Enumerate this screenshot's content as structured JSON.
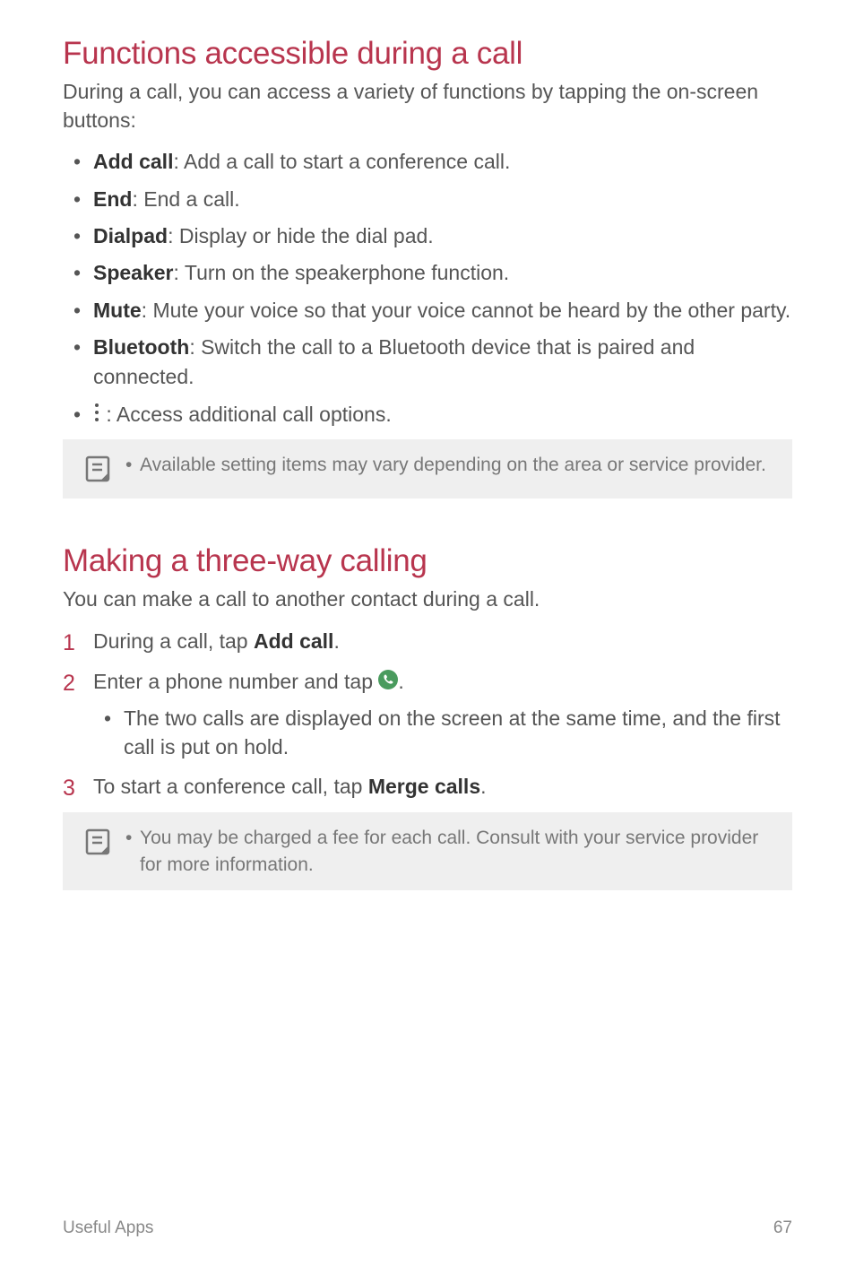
{
  "section1": {
    "heading": "Functions accessible during a call",
    "intro": "During a call, you can access a variety of functions by tapping the on-screen buttons:",
    "items": [
      {
        "label": "Add call",
        "desc": ": Add a call to start a conference call."
      },
      {
        "label": "End",
        "desc": ": End a call."
      },
      {
        "label": "Dialpad",
        "desc": ": Display or hide the dial pad."
      },
      {
        "label": "Speaker",
        "desc": ": Turn on the speakerphone function."
      },
      {
        "label": "Mute",
        "desc": ": Mute your voice so that your voice cannot be heard by the other party."
      },
      {
        "label": "Bluetooth",
        "desc": ": Switch the call to a Bluetooth device that is paired and connected."
      }
    ],
    "moreOptionsDesc": " : Access additional call options.",
    "note": "Available setting items may vary depending on the area or service provider."
  },
  "section2": {
    "heading": "Making a three-way calling",
    "intro": "You can make a call to another contact during a call.",
    "step1_pre": "During a call, tap ",
    "step1_bold": "Add call",
    "step1_post": ".",
    "step2_pre": "Enter a phone number and tap ",
    "step2_post": ".",
    "step2_sub": "The two calls are displayed on the screen at the same time, and the first call is put on hold.",
    "step3_pre": "To start a conference call, tap ",
    "step3_bold": "Merge calls",
    "step3_post": ".",
    "note": "You may be charged a fee for each call. Consult with your service provider for more information."
  },
  "footer": {
    "left": "Useful Apps",
    "right": "67"
  },
  "nums": {
    "n1": "1",
    "n2": "2",
    "n3": "3"
  }
}
